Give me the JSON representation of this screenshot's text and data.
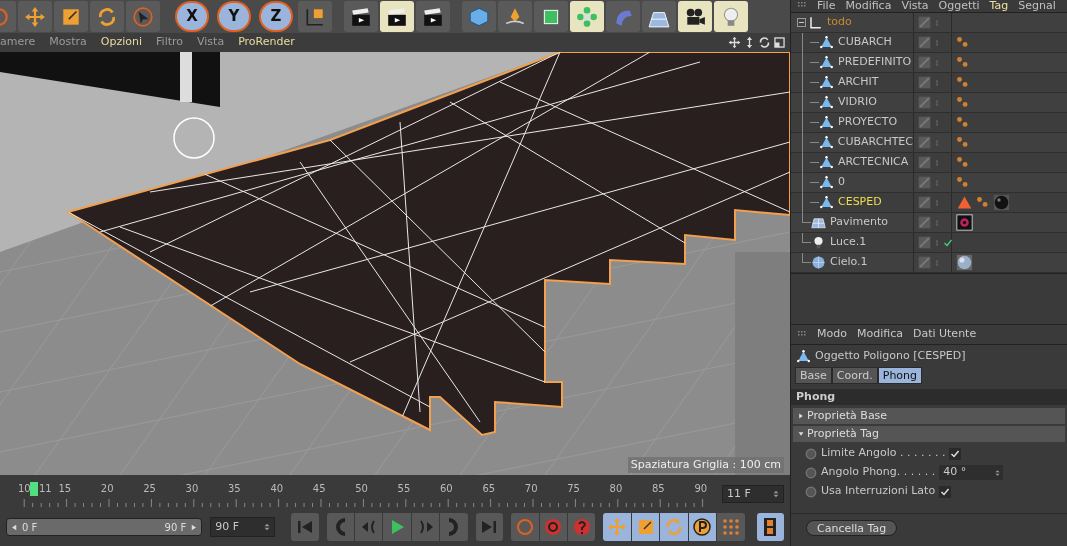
{
  "toolbar": [
    {
      "kind": "record",
      "selected": false
    },
    {
      "kind": "move",
      "selected": false
    },
    {
      "kind": "scale",
      "selected": false
    },
    {
      "kind": "rotate",
      "selected": false
    },
    {
      "kind": "pointer",
      "selected": false
    },
    {
      "kind": "axis",
      "label": "X",
      "selected": true
    },
    {
      "kind": "axis",
      "label": "Y",
      "selected": true
    },
    {
      "kind": "axis",
      "label": "Z",
      "selected": true
    },
    {
      "kind": "coords",
      "selected": false
    },
    {
      "kind": "clapper",
      "selected": false
    },
    {
      "kind": "clapper",
      "selected": true
    },
    {
      "kind": "clapper",
      "selected": false
    },
    {
      "kind": "cube",
      "selected": false
    },
    {
      "kind": "pen",
      "selected": false
    },
    {
      "kind": "subdivide",
      "selected": false
    },
    {
      "kind": "cloner",
      "selected": true
    },
    {
      "kind": "bend",
      "selected": false
    },
    {
      "kind": "floor",
      "selected": false
    },
    {
      "kind": "camera",
      "selected": true
    },
    {
      "kind": "bulb",
      "selected": true
    }
  ],
  "viewport": {
    "menu": [
      {
        "label": "amere",
        "highlighted": false
      },
      {
        "label": "Mostra",
        "highlighted": false
      },
      {
        "label": "Opzioni",
        "highlighted": true
      },
      {
        "label": "Filtro",
        "highlighted": false
      },
      {
        "label": "Vista",
        "highlighted": false
      },
      {
        "label": "ProRender",
        "highlighted": true
      }
    ],
    "grid_info": "Spaziatura Griglia : 100 cm"
  },
  "timeline": {
    "current": "11",
    "labels": [
      "10",
      "15",
      "20",
      "25",
      "30",
      "35",
      "40",
      "45",
      "50",
      "55",
      "60",
      "65",
      "70",
      "75",
      "80",
      "85",
      "90"
    ],
    "frame_field": "11 F",
    "range_slider": {
      "start": "0 F",
      "end": "90 F",
      "level": 1
    },
    "end_field": "90 F",
    "controls": [
      {
        "kind": "first",
        "selected": false
      },
      {
        "kind": "prev-key",
        "selected": false
      },
      {
        "kind": "prev-frame",
        "selected": false
      },
      {
        "kind": "play",
        "selected": false
      },
      {
        "kind": "next-frame",
        "selected": false
      },
      {
        "kind": "next-key",
        "selected": false
      },
      {
        "kind": "last",
        "selected": false
      },
      {
        "kind": "record",
        "selected": false
      },
      {
        "kind": "autokey",
        "selected": false
      },
      {
        "kind": "help",
        "selected": false
      },
      {
        "kind": "move",
        "selected": true
      },
      {
        "kind": "scale",
        "selected": true
      },
      {
        "kind": "rotate",
        "selected": true
      },
      {
        "kind": "param",
        "selected": true
      },
      {
        "kind": "points",
        "selected": false
      },
      {
        "kind": "film",
        "selected": true
      }
    ]
  },
  "object_manager": {
    "menu": [
      {
        "label": "File",
        "highlighted": false
      },
      {
        "label": "Modifica",
        "highlighted": false
      },
      {
        "label": "Vista",
        "highlighted": false
      },
      {
        "label": "Oggetti",
        "highlighted": false
      },
      {
        "label": "Tag",
        "highlighted": true
      },
      {
        "label": "Segnal",
        "highlighted": false
      }
    ],
    "objects": [
      {
        "name": "todo",
        "kind": "null",
        "highlighted": true,
        "selected": false,
        "expanded": true,
        "enabled_check": false,
        "children": [
          {
            "name": "CUBARCH",
            "kind": "polygon",
            "selected": false,
            "enabled_check": false,
            "tags": [
              {
                "kind": "phong"
              }
            ]
          },
          {
            "name": "PREDEFINITO",
            "kind": "polygon",
            "selected": false,
            "enabled_check": false,
            "tags": [
              {
                "kind": "phong"
              }
            ]
          },
          {
            "name": "ARCHIT",
            "kind": "polygon",
            "selected": false,
            "enabled_check": false,
            "tags": [
              {
                "kind": "phong"
              }
            ]
          },
          {
            "name": "VIDRIO",
            "kind": "polygon",
            "selected": false,
            "enabled_check": false,
            "tags": [
              {
                "kind": "phong"
              }
            ]
          },
          {
            "name": "PROYECTO",
            "kind": "polygon",
            "selected": false,
            "enabled_check": false,
            "tags": [
              {
                "kind": "phong"
              }
            ]
          },
          {
            "name": "CUBARCHTEC",
            "kind": "polygon",
            "selected": false,
            "enabled_check": false,
            "tags": [
              {
                "kind": "phong"
              }
            ]
          },
          {
            "name": "ARCTECNICA",
            "kind": "polygon",
            "selected": false,
            "enabled_check": false,
            "tags": [
              {
                "kind": "phong"
              }
            ]
          },
          {
            "name": "0",
            "kind": "polygon",
            "selected": false,
            "enabled_check": false,
            "tags": [
              {
                "kind": "phong"
              }
            ]
          },
          {
            "name": "CESPED",
            "kind": "polygon",
            "selected": true,
            "enabled_check": false,
            "tags": [
              {
                "kind": "triangle"
              },
              {
                "kind": "phong"
              },
              {
                "kind": "material"
              }
            ]
          }
        ]
      },
      {
        "name": "Pavimento",
        "kind": "floor",
        "selected": false,
        "enabled_check": false,
        "tags": [
          {
            "kind": "render"
          }
        ]
      },
      {
        "name": "Luce.1",
        "kind": "light",
        "selected": false,
        "enabled_check": true
      },
      {
        "name": "Cielo.1",
        "kind": "sky",
        "selected": false,
        "enabled_check": false,
        "tags": [
          {
            "kind": "sky-material"
          }
        ]
      }
    ]
  },
  "attributes": {
    "menu": [
      "Modo",
      "Modifica",
      "Dati Utente"
    ],
    "title": "Oggetto Poligono [CESPED]",
    "tabs": [
      {
        "label": "Base",
        "selected": false
      },
      {
        "label": "Coord.",
        "selected": false
      },
      {
        "label": "Phong",
        "selected": true
      }
    ],
    "section": "Phong",
    "groups": [
      {
        "label": "Proprietà Base",
        "expanded": false
      },
      {
        "label": "Proprietà Tag",
        "expanded": true
      }
    ],
    "fields": [
      {
        "kind": "checkbox",
        "label": "Limite Angolo . . . . . . .",
        "checked": true
      },
      {
        "kind": "number",
        "label": "Angolo Phong. . . . . .",
        "value": "40 °"
      },
      {
        "kind": "checkbox",
        "label": "Usa Interruzioni Lato",
        "checked": true
      }
    ],
    "button": "Cancella Tag"
  }
}
